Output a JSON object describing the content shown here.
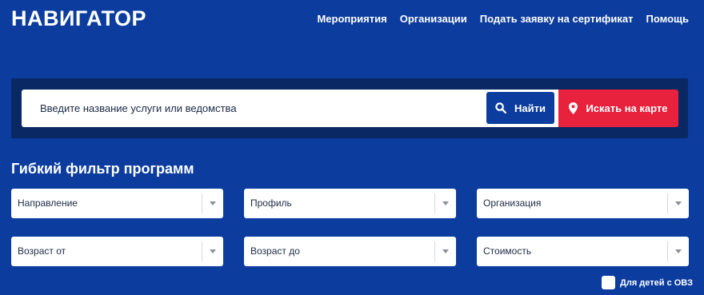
{
  "header": {
    "logo": "НАВИГАТОР",
    "nav": [
      "Мероприятия",
      "Организации",
      "Подать заявку на сертификат",
      "Помощь"
    ]
  },
  "search": {
    "placeholder": "Введите название услуги или ведомства",
    "find_label": "Найти",
    "map_label": "Искать на карте"
  },
  "filter": {
    "title": "Гибкий фильтр программ",
    "selects": [
      "Направление",
      "Профиль",
      "Организация",
      "Возраст от",
      "Возраст до",
      "Стоимость"
    ],
    "ovz_label": "Для детей с ОВЗ"
  },
  "colors": {
    "background": "#0B3C9E",
    "panel": "#0A2864",
    "accent_red": "#E8213C"
  },
  "icons": [
    "search-icon",
    "map-pin-icon",
    "chevron-down-icon",
    "checkbox-icon"
  ]
}
